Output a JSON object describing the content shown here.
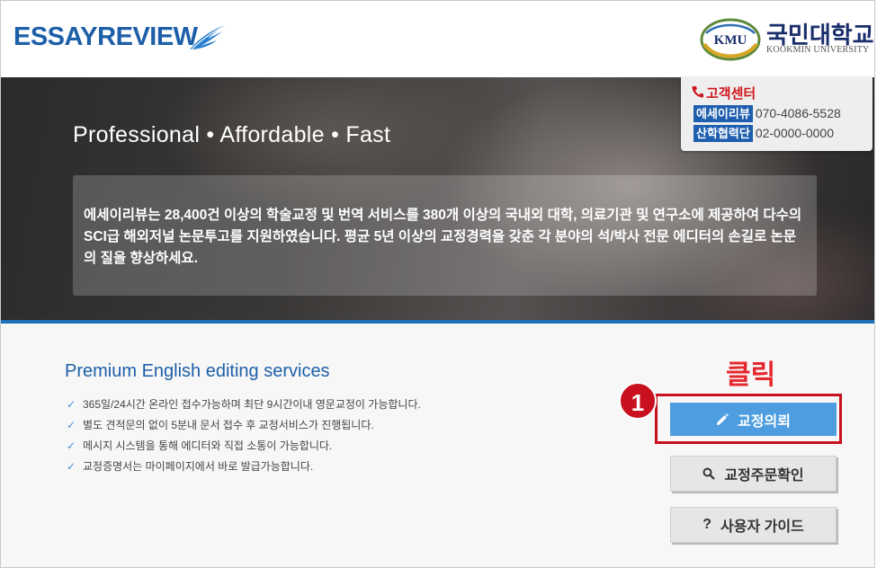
{
  "header": {
    "brand": "ESSAYREVIEW",
    "university": {
      "logo_text": "KMU",
      "name_ko": "국민대학교",
      "name_en": "KOOKMIN UNIVERSITY"
    }
  },
  "hero": {
    "tagline": "Professional • Affordable • Fast",
    "intro": "에세이리뷰는 28,400건 이상의 학술교정 및 번역 서비스를 380개 이상의 국내외 대학, 의료기관 및 연구소에 제공하여 다수의 SCI급 해외저널 논문투고를 지원하였습니다. 평균 5년 이상의 교정경력을 갖춘 각 분야의 석/박사 전문 에디터의 손길로 논문의 질을 향상하세요."
  },
  "customer_center": {
    "title": "고객센터",
    "rows": [
      {
        "label": "에세이리뷰",
        "number": "070-4086-5528"
      },
      {
        "label": "산학협력단",
        "number": "02-0000-0000"
      }
    ]
  },
  "services": {
    "title": "Premium English editing services",
    "items": [
      "365일/24시간 온라인 접수가능하며 최단 9시간이내 영문교정이 가능합니다.",
      "별도 견적문의 없이 5분내 문서 접수 후 교정서비스가 진행됩니다.",
      "메시지 시스템을 통해 에디터와 직접 소통이 가능합니다.",
      "교정증명서는 마이페이지에서 바로 발급가능합니다."
    ]
  },
  "annotation": {
    "click_label": "클릭",
    "step_number": "1",
    "color": "#c8101e"
  },
  "buttons": {
    "request": {
      "label": "교정의뢰",
      "icon": "pencil-icon"
    },
    "check_order": {
      "label": "교정주문확인",
      "icon": "search-icon"
    },
    "guide": {
      "label": "사용자 가이드",
      "icon": "question-icon"
    }
  },
  "colors": {
    "brand_blue": "#1d5fa8",
    "accent_blue": "#4d9de0",
    "red": "#e5282e"
  }
}
